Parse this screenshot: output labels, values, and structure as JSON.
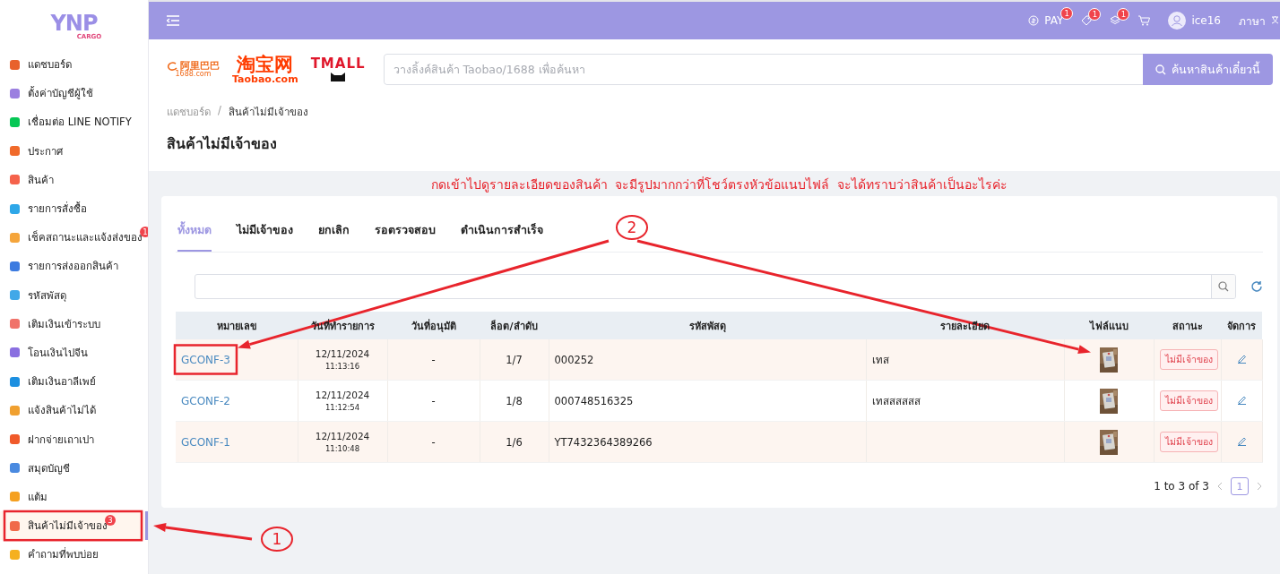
{
  "brand": {
    "name": "YNP",
    "sub": "CARGO"
  },
  "sidebar": {
    "items": [
      {
        "label": "แดชบอร์ด",
        "selected": false
      },
      {
        "label": "ตั้งค่าบัญชีผู้ใช้",
        "selected": false
      },
      {
        "label": "เชื่อมต่อ LINE NOTIFY",
        "selected": false
      },
      {
        "label": "ประกาศ",
        "selected": false
      },
      {
        "label": "สินค้า",
        "selected": false
      },
      {
        "label": "รายการสั่งซื้อ",
        "selected": false
      },
      {
        "label": "เช็คสถานะและแจ้งส่งของ",
        "selected": false,
        "badge": "1"
      },
      {
        "label": "รายการส่งออกสินค้า",
        "selected": false
      },
      {
        "label": "รหัสพัสดุ",
        "selected": false
      },
      {
        "label": "เติมเงินเข้าระบบ",
        "selected": false
      },
      {
        "label": "โอนเงินไปจีน",
        "selected": false
      },
      {
        "label": "เติมเงินอาลีเพย์",
        "selected": false
      },
      {
        "label": "แจ้งสินค้าไม่ได้",
        "selected": false
      },
      {
        "label": "ฝากจ่ายเถาเปา",
        "selected": false
      },
      {
        "label": "สมุดบัญชี",
        "selected": false
      },
      {
        "label": "แต้ม",
        "selected": false
      },
      {
        "label": "สินค้าไม่มีเจ้าของ",
        "selected": true,
        "badge": "3"
      },
      {
        "label": "คำถามที่พบบ่อย",
        "selected": false
      }
    ]
  },
  "topbar": {
    "pay": {
      "label": "PAY",
      "badge": "1"
    },
    "coupon_badge": "1",
    "layers_badge": "1",
    "user": "ice16",
    "language": "ภาษา"
  },
  "shops": [
    {
      "kind": "alibaba",
      "text": "阿里巴巴",
      "sub": "1688.com"
    },
    {
      "kind": "taobao",
      "text": "淘宝网",
      "sub": "Taobao.com"
    },
    {
      "kind": "tmall",
      "text": "TMALL"
    }
  ],
  "product_search": {
    "placeholder": "วางลิ้งค์สินค้า Taobao/1688 เพื่อค้นหา",
    "button": "ค้นหาสินค้าเดี๋ยวนี้"
  },
  "breadcrumb": [
    "แดชบอร์ด",
    "สินค้าไม่มีเจ้าของ"
  ],
  "breadcrumb_separator": "/",
  "page_title": "สินค้าไม่มีเจ้าของ",
  "tabs": [
    {
      "label": "ทั้งหมด",
      "selected": true
    },
    {
      "label": "ไม่มีเจ้าของ",
      "selected": false
    },
    {
      "label": "ยกเลิก",
      "selected": false
    },
    {
      "label": "รอตรวจสอบ",
      "selected": false
    },
    {
      "label": "ดำเนินการสำเร็จ",
      "selected": false
    }
  ],
  "table": {
    "columns": [
      "หมายเลข",
      "วันที่ทำรายการ",
      "วันที่อนุมัติ",
      "ล็อต/ลำดับ",
      "รหัสพัสดุ",
      "รายละเอียด",
      "ไฟล์แนบ",
      "สถานะ",
      "จัดการ"
    ],
    "rows": [
      {
        "number": "GCONF-3",
        "date": "12/11/2024",
        "time": "11:13:16",
        "approved": "-",
        "lot": "1/7",
        "parcel": "000252",
        "details": "เทส",
        "status": "ไม่มีเจ้าของ"
      },
      {
        "number": "GCONF-2",
        "date": "12/11/2024",
        "time": "11:12:54",
        "approved": "-",
        "lot": "1/8",
        "parcel": "000748516325",
        "details": "เทสสสสสส",
        "status": "ไม่มีเจ้าของ"
      },
      {
        "number": "GCONF-1",
        "date": "12/11/2024",
        "time": "11:10:48",
        "approved": "-",
        "lot": "1/6",
        "parcel": "YT7432364389266",
        "status": "ไม่มีเจ้าของ"
      }
    ]
  },
  "pagination": {
    "summary": "1 to 3 of 3",
    "pages": [
      {
        "label": "1",
        "selected": true
      }
    ]
  },
  "annotations": {
    "note": "กดเข้าไปดูรายละเอียดของสินค้า  จะมีรูปมากกว่าที่โชว์ตรงหัวข้อแนบไฟล์  จะได้ทราบว่าสินค้าเป็นอะไรค่ะ",
    "callouts": [
      "1",
      "2"
    ]
  }
}
